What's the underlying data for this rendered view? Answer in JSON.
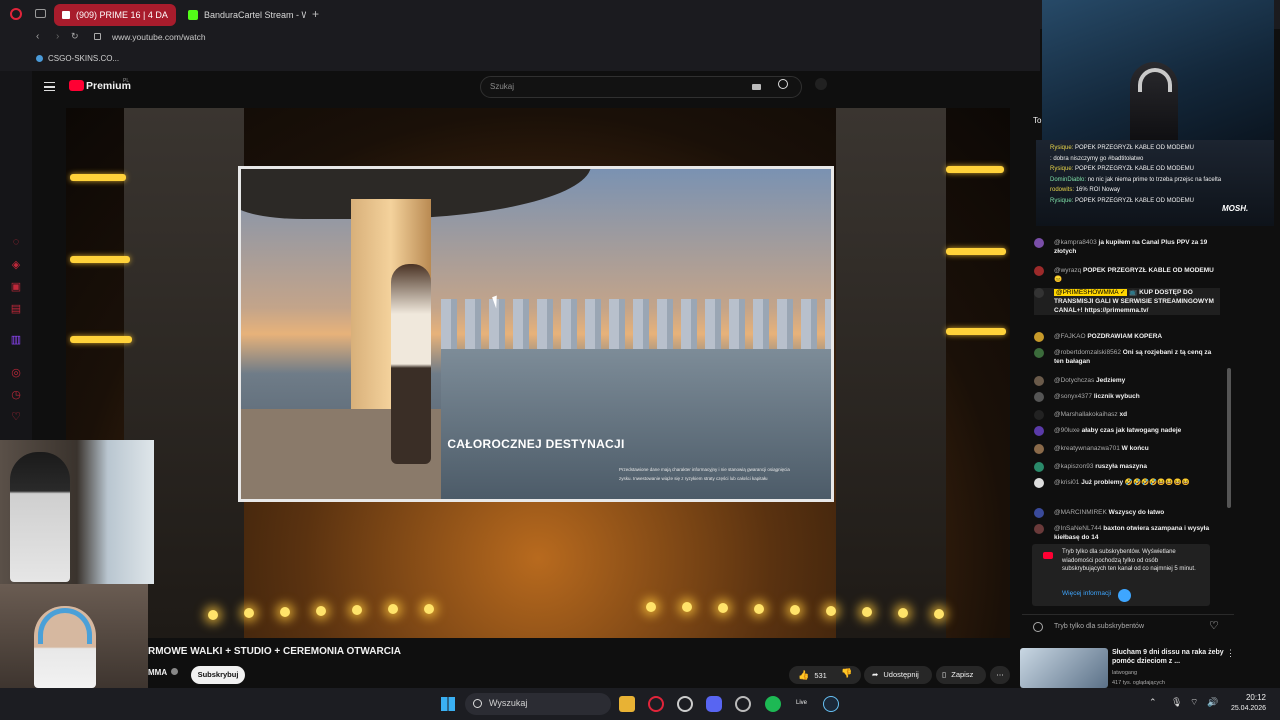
{
  "browser": {
    "tabs": [
      {
        "label": "(909) PRIME 16 | 4 DA",
        "active": true
      },
      {
        "label": "BanduraCartel Stream - W",
        "active": false
      }
    ],
    "url": "www.youtube.com/watch",
    "bookmark": "CSGO-SKINS.CO..."
  },
  "youtube": {
    "logo_text": "Premium",
    "logo_sup": "PL",
    "search_placeholder": "Szukaj"
  },
  "player": {
    "caption": "CAŁOROCZNEJ DESTYNACJI",
    "disclaimer_line1": "Przedstawione dane mają charakter informacyjny i nie stanowią gwarancji osiągnięcia",
    "disclaimer_line2": "zysku. Inwestowanie wiąże się z ryzykiem straty części lub całości kapitału"
  },
  "overlay_chat": [
    {
      "author": "Rysique:",
      "text": "POPEK PRZEGRYZŁ KABLE OD MODEMU"
    },
    {
      "author": "",
      "text": ": dobra niszczymy go #badtitołatwo"
    },
    {
      "author": "Rysique:",
      "text": "POPEK PRZEGRYZŁ KABLE OD MODEMU"
    },
    {
      "author": "DominDiablo:",
      "text": "no nic jak niema prime to trzeba przejsc na facelta"
    },
    {
      "author": "rodowits:",
      "text": "16% ROI Noway"
    },
    {
      "author": "Rysique:",
      "text": "POPEK PRZEGRYZŁ KABLE OD MODEMU"
    }
  ],
  "overlay_brand": "MOSH.",
  "chat": {
    "header": "Top",
    "messages": [
      {
        "author": "@kampra8403",
        "text": "ja kupiłem na Canal Plus PPV za 19 złotych",
        "color": "#7a4ea8"
      },
      {
        "author": "@wyrazq",
        "text": "POPEK PRZEGRYZŁ KABLE OD MODEMU 😑",
        "color": "#9c2a2a"
      },
      {
        "author": "@PRIMESHOWMMA ✓",
        "text": "📺 KUP DOSTĘP DO TRANSMISJI GALI W SERWISIE STREAMINGOWYM CANAL+! https://primemma.tv/",
        "color": "#333333"
      },
      {
        "author": "@FAJKAO",
        "text": "POZDRAWIAM KOPERA",
        "color": "#c79a2a"
      },
      {
        "author": "@robertdomzalski8562",
        "text": "Oni są rozjebani z tą cenq za ten bałagan",
        "color": "#3b6b3b"
      },
      {
        "author": "@Dotychczas",
        "text": "Jedziemy",
        "color": "#6a5a4a"
      },
      {
        "author": "@sonyx4377",
        "text": "licznik wybuch",
        "color": "#555555"
      },
      {
        "author": "@Marshallakokaihasz",
        "text": "xd",
        "color": "#222222"
      },
      {
        "author": "@90luxe",
        "text": "ałaby czas jak łatwogang nadeje",
        "color": "#5a3aa8"
      },
      {
        "author": "@kreatywnanazwa701",
        "text": "W końcu",
        "color": "#8a6a4a"
      },
      {
        "author": "@kapiszon93",
        "text": "ruszyła maszyna",
        "color": "#2a8a6a"
      },
      {
        "author": "@krisi01",
        "text": "Już problemy 🤣🤣🤣🤣😆😆😆😆",
        "color": "#dddddd"
      },
      {
        "author": "@MARCINMIREK",
        "text": "Wszyscy do łatwo",
        "color": "#3a4a9a"
      },
      {
        "author": "@InSaNeNL744",
        "text": "baxton otwiera szampana i wysyła kiełbasę do 14",
        "color": "#6a3a3a"
      }
    ],
    "notice": "Tryb tylko dla subskrybentów. Wyświetlane wiadomości pochodzą tylko od osób subskrybujących ten kanał od co najmniej 5 minut.",
    "notice_link": "Więcej informacji",
    "input_placeholder": "Tryb tylko dla subskrybentów"
  },
  "video": {
    "title": "RMOWE WALKI + STUDIO + CEREMONIA OTWARCIA",
    "channel": "MMA",
    "subscribe": "Subskrybuj",
    "likes": "531",
    "share": "Udostępnij",
    "save": "Zapisz"
  },
  "related": {
    "title": "Słucham 9 dni dissu na raka żeby pomóc dzieciom z ...",
    "channel": "latwogang",
    "meta": "417 tys. oglądających"
  },
  "taskbar": {
    "search": "Wyszukaj",
    "live_label": "Live",
    "time": "20:12",
    "date": "25.04.2026"
  },
  "colors": {
    "accent_red": "#ff0033",
    "opera_red": "#c0283a",
    "stage_gold": "#ffd23a"
  }
}
